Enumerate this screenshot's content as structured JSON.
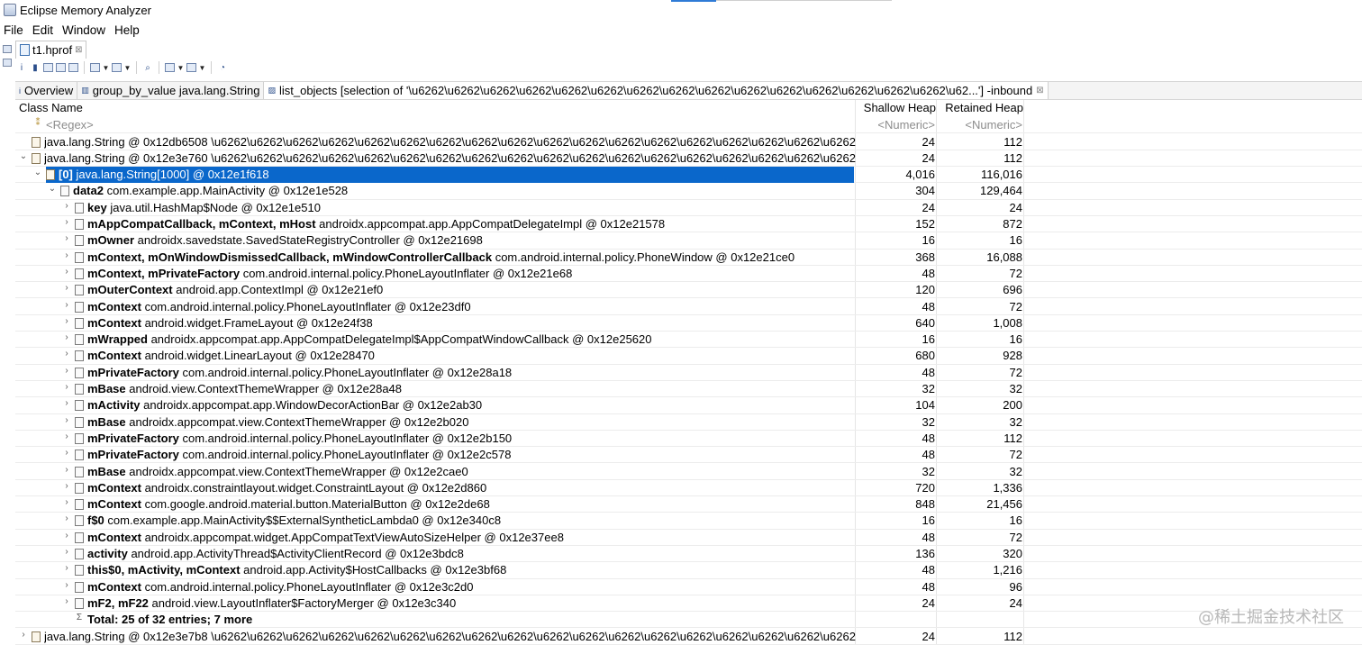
{
  "window": {
    "title": "Eclipse Memory Analyzer"
  },
  "menu": [
    "File",
    "Edit",
    "Window",
    "Help"
  ],
  "editor_tab": {
    "label": "t1.hprof",
    "close": "⊠"
  },
  "toolbar_icons": [
    "info-icon",
    "histogram-icon",
    "dominator-tree-icon",
    "oql-icon",
    "thread-overview-icon",
    "reports-icon",
    "query-browser-icon",
    "search-icon",
    "layout-icon",
    "export-icon",
    "pie-chart-icon"
  ],
  "query_tabs": [
    {
      "label": "Overview",
      "icon": "i"
    },
    {
      "label": "group_by_value  java.lang.String",
      "icon": "▥"
    },
    {
      "label": "list_objects  [selection of '\\u6262\\u6262\\u6262\\u6262\\u6262\\u6262\\u6262\\u6262\\u6262\\u6262\\u6262\\u6262\\u6262\\u6262\\u6262\\u62...'] -inbound",
      "icon": "▨",
      "close": "⊠"
    }
  ],
  "columns": {
    "class_name": "Class Name",
    "shallow": "Shallow Heap",
    "retained": "Retained Heap"
  },
  "filters": {
    "name": "<Regex>",
    "shallow": "<Numeric>",
    "retained": "<Numeric>"
  },
  "rows": [
    {
      "level": 0,
      "twisty": "",
      "field": "",
      "text": "java.lang.String @ 0x12db6508  \\u6262\\u6262\\u6262\\u6262\\u6262\\u6262\\u6262\\u6262\\u6262\\u6262\\u6262\\u6262\\u6262\\u6262\\u6262\\u6262\\u6262\\u6262",
      "shallow": "24",
      "retained": "112"
    },
    {
      "level": 0,
      "twisty": "⌄",
      "field": "",
      "text": "java.lang.String @ 0x12e3e760  \\u6262\\u6262\\u6262\\u6262\\u6262\\u6262\\u6262\\u6262\\u6262\\u6262\\u6262\\u6262\\u6262\\u6262\\u6262\\u6262\\u6262\\u6262",
      "shallow": "24",
      "retained": "112"
    },
    {
      "level": 1,
      "twisty": "⌄",
      "field": "[0]",
      "text": "java.lang.String[1000] @ 0x12e1f618",
      "shallow": "4,016",
      "retained": "116,016",
      "selected": true
    },
    {
      "level": 2,
      "twisty": "⌄",
      "field": "data2",
      "text": "com.example.app.MainActivity @ 0x12e1e528",
      "shallow": "304",
      "retained": "129,464"
    },
    {
      "level": 3,
      "twisty": "›",
      "field": "key",
      "text": "java.util.HashMap$Node @ 0x12e1e510",
      "shallow": "24",
      "retained": "24"
    },
    {
      "level": 3,
      "twisty": "›",
      "field": "mAppCompatCallback, mContext, mHost",
      "text": "androidx.appcompat.app.AppCompatDelegateImpl @ 0x12e21578",
      "shallow": "152",
      "retained": "872"
    },
    {
      "level": 3,
      "twisty": "›",
      "field": "mOwner",
      "text": "androidx.savedstate.SavedStateRegistryController @ 0x12e21698",
      "shallow": "16",
      "retained": "16"
    },
    {
      "level": 3,
      "twisty": "›",
      "field": "mContext, mOnWindowDismissedCallback, mWindowControllerCallback",
      "text": "com.android.internal.policy.PhoneWindow @ 0x12e21ce0",
      "shallow": "368",
      "retained": "16,088"
    },
    {
      "level": 3,
      "twisty": "›",
      "field": "mContext, mPrivateFactory",
      "text": "com.android.internal.policy.PhoneLayoutInflater @ 0x12e21e68",
      "shallow": "48",
      "retained": "72"
    },
    {
      "level": 3,
      "twisty": "›",
      "field": "mOuterContext",
      "text": "android.app.ContextImpl @ 0x12e21ef0",
      "shallow": "120",
      "retained": "696"
    },
    {
      "level": 3,
      "twisty": "›",
      "field": "mContext",
      "text": "com.android.internal.policy.PhoneLayoutInflater @ 0x12e23df0",
      "shallow": "48",
      "retained": "72"
    },
    {
      "level": 3,
      "twisty": "›",
      "field": "mContext",
      "text": "android.widget.FrameLayout @ 0x12e24f38",
      "shallow": "640",
      "retained": "1,008"
    },
    {
      "level": 3,
      "twisty": "›",
      "field": "mWrapped",
      "text": "androidx.appcompat.app.AppCompatDelegateImpl$AppCompatWindowCallback @ 0x12e25620",
      "shallow": "16",
      "retained": "16"
    },
    {
      "level": 3,
      "twisty": "›",
      "field": "mContext",
      "text": "android.widget.LinearLayout @ 0x12e28470",
      "shallow": "680",
      "retained": "928"
    },
    {
      "level": 3,
      "twisty": "›",
      "field": "mPrivateFactory",
      "text": "com.android.internal.policy.PhoneLayoutInflater @ 0x12e28a18",
      "shallow": "48",
      "retained": "72"
    },
    {
      "level": 3,
      "twisty": "›",
      "field": "mBase",
      "text": "android.view.ContextThemeWrapper @ 0x12e28a48",
      "shallow": "32",
      "retained": "32"
    },
    {
      "level": 3,
      "twisty": "›",
      "field": "mActivity",
      "text": "androidx.appcompat.app.WindowDecorActionBar @ 0x12e2ab30",
      "shallow": "104",
      "retained": "200"
    },
    {
      "level": 3,
      "twisty": "›",
      "field": "mBase",
      "text": "androidx.appcompat.view.ContextThemeWrapper @ 0x12e2b020",
      "shallow": "32",
      "retained": "32"
    },
    {
      "level": 3,
      "twisty": "›",
      "field": "mPrivateFactory",
      "text": "com.android.internal.policy.PhoneLayoutInflater @ 0x12e2b150",
      "shallow": "48",
      "retained": "112"
    },
    {
      "level": 3,
      "twisty": "›",
      "field": "mPrivateFactory",
      "text": "com.android.internal.policy.PhoneLayoutInflater @ 0x12e2c578",
      "shallow": "48",
      "retained": "72"
    },
    {
      "level": 3,
      "twisty": "›",
      "field": "mBase",
      "text": "androidx.appcompat.view.ContextThemeWrapper @ 0x12e2cae0",
      "shallow": "32",
      "retained": "32"
    },
    {
      "level": 3,
      "twisty": "›",
      "field": "mContext",
      "text": "androidx.constraintlayout.widget.ConstraintLayout @ 0x12e2d860",
      "shallow": "720",
      "retained": "1,336"
    },
    {
      "level": 3,
      "twisty": "›",
      "field": "mContext",
      "text": "com.google.android.material.button.MaterialButton @ 0x12e2de68",
      "shallow": "848",
      "retained": "21,456"
    },
    {
      "level": 3,
      "twisty": "›",
      "field": "f$0",
      "text": "com.example.app.MainActivity$$ExternalSyntheticLambda0 @ 0x12e340c8",
      "shallow": "16",
      "retained": "16"
    },
    {
      "level": 3,
      "twisty": "›",
      "field": "mContext",
      "text": "androidx.appcompat.widget.AppCompatTextViewAutoSizeHelper @ 0x12e37ee8",
      "shallow": "48",
      "retained": "72"
    },
    {
      "level": 3,
      "twisty": "›",
      "field": "activity",
      "text": "android.app.ActivityThread$ActivityClientRecord @ 0x12e3bdc8",
      "shallow": "136",
      "retained": "320"
    },
    {
      "level": 3,
      "twisty": "›",
      "field": "this$0, mActivity, mContext",
      "text": "android.app.Activity$HostCallbacks @ 0x12e3bf68",
      "shallow": "48",
      "retained": "1,216"
    },
    {
      "level": 3,
      "twisty": "›",
      "field": "mContext",
      "text": "com.android.internal.policy.PhoneLayoutInflater @ 0x12e3c2d0",
      "shallow": "48",
      "retained": "96"
    },
    {
      "level": 3,
      "twisty": "›",
      "field": "mF2, mF22",
      "text": "android.view.LayoutInflater$FactoryMerger @ 0x12e3c340",
      "shallow": "24",
      "retained": "24"
    },
    {
      "level": 3,
      "twisty": "",
      "field": "Total: 25 of 32 entries; 7 more",
      "text": "",
      "shallow": "",
      "retained": "",
      "total": true
    },
    {
      "level": 0,
      "twisty": "›",
      "field": "",
      "text": "java.lang.String @ 0x12e3e7b8  \\u6262\\u6262\\u6262\\u6262\\u6262\\u6262\\u6262\\u6262\\u6262\\u6262\\u6262\\u6262\\u6262\\u6262\\u6262\\u6262\\u6262\\u6262",
      "shallow": "24",
      "retained": "112"
    }
  ],
  "watermark": "@稀土掘金技术社区",
  "colors": {
    "selection": "#0a67cb",
    "accent": "#2f7bd6"
  }
}
